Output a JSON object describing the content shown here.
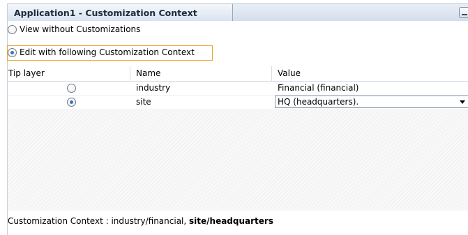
{
  "panel": {
    "title": "Application1 - Customization Context",
    "minimize_icon": "minimize-icon"
  },
  "mode": {
    "option_view": "View without Customizations",
    "option_edit": "Edit with following Customization Context",
    "selected": "edit"
  },
  "table": {
    "headers": [
      "Tip layer",
      "Name",
      "Value"
    ],
    "rows": [
      {
        "tip_layer_selected": false,
        "name": "industry",
        "value": "Financial (financial)"
      },
      {
        "tip_layer_selected": true,
        "name": "site",
        "value": "HQ (headquarters)."
      }
    ]
  },
  "footer": {
    "label": "Customization Context : industry/financial, ",
    "bold": "site/headquarters"
  },
  "colors": {
    "focus_border": "#e9a53a",
    "tab_gradient_top": "#f4f7fb",
    "tab_gradient_bottom": "#d9e3ef"
  }
}
